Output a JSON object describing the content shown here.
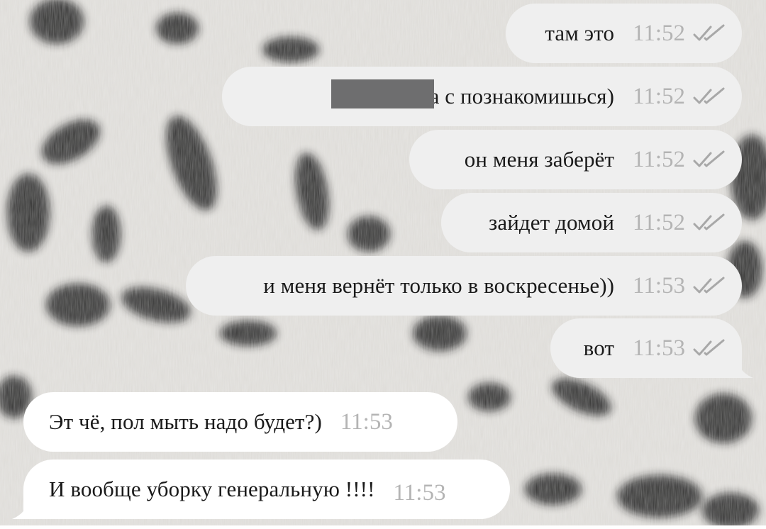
{
  "colors": {
    "outgoing_bubble": "#efefef",
    "incoming_bubble": "#ffffff",
    "timestamp": "#b4b4b4",
    "text": "#1a1a1a",
    "ticks": "#a8a8a8",
    "redaction": "#6e6e6f"
  },
  "background": {
    "description_icon": "snow-leopard-fur-wallpaper"
  },
  "messages": [
    {
      "direction": "outgoing",
      "text": "там это",
      "time": "11:52",
      "status": "read-double-check-icon"
    },
    {
      "direction": "outgoing",
      "text": "завтра с        познакомишься)",
      "time": "11:52",
      "status": "read-double-check-icon",
      "redacted": true
    },
    {
      "direction": "outgoing",
      "text": "он меня заберёт",
      "time": "11:52",
      "status": "read-double-check-icon"
    },
    {
      "direction": "outgoing",
      "text": "зайдет домой",
      "time": "11:52",
      "status": "read-double-check-icon"
    },
    {
      "direction": "outgoing",
      "text": "и меня вернёт только в воскресенье))",
      "time": "11:53",
      "status": "read-double-check-icon"
    },
    {
      "direction": "outgoing",
      "text": "вот",
      "time": "11:53",
      "status": "read-double-check-icon"
    },
    {
      "direction": "incoming",
      "text": "Эт чё, пол мыть надо будет?)",
      "time": "11:53"
    },
    {
      "direction": "incoming",
      "text": "И вообще уборку генеральную !!!!",
      "time": "11:53"
    }
  ]
}
